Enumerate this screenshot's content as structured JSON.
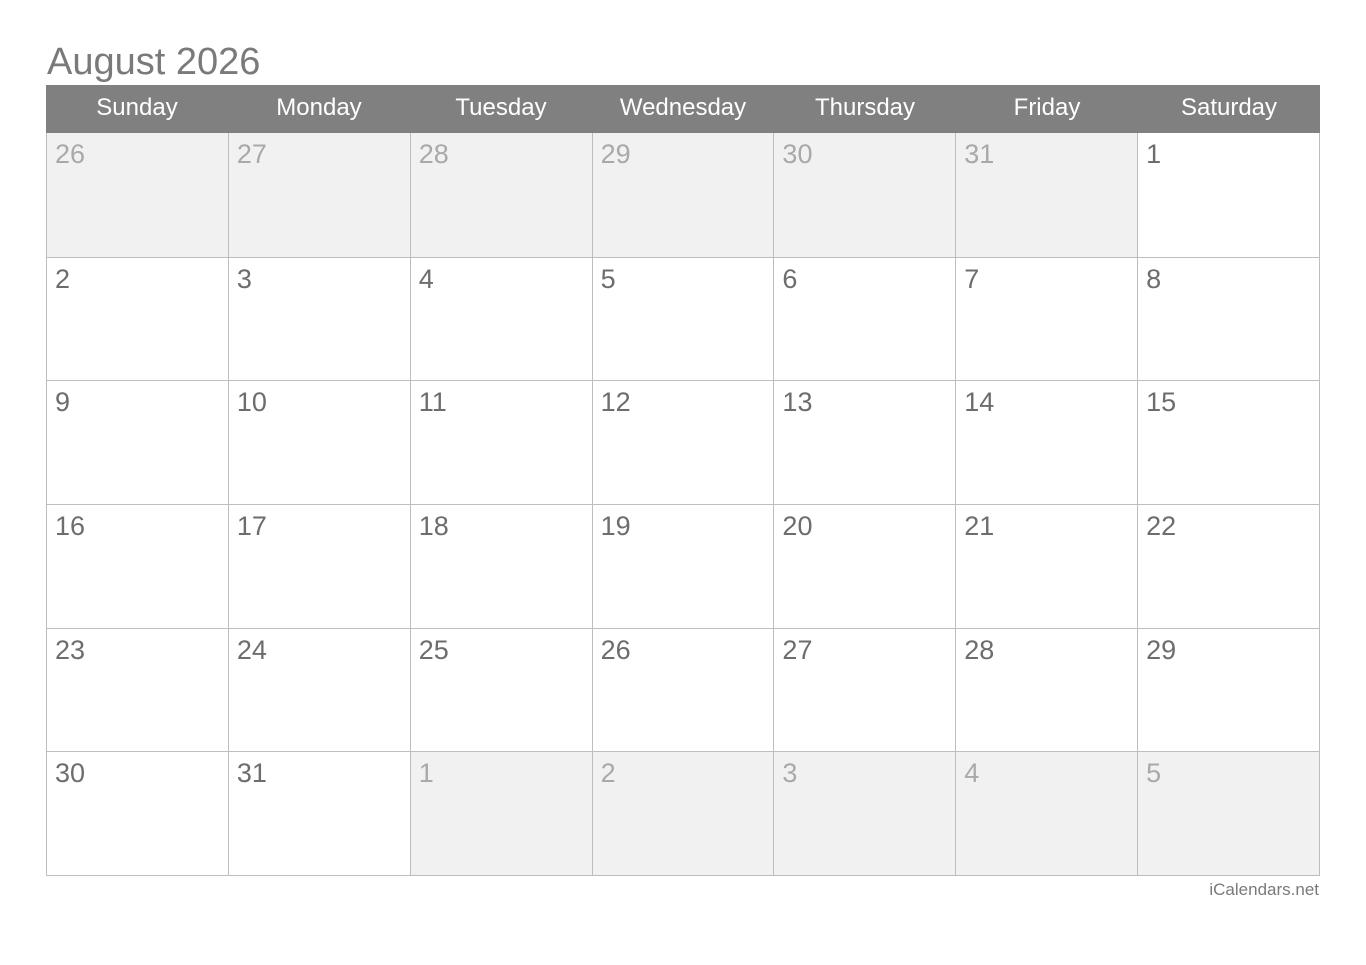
{
  "title": "August 2026",
  "weekdays": [
    "Sunday",
    "Monday",
    "Tuesday",
    "Wednesday",
    "Thursday",
    "Friday",
    "Saturday"
  ],
  "weeks": [
    [
      {
        "d": "26",
        "other": true
      },
      {
        "d": "27",
        "other": true
      },
      {
        "d": "28",
        "other": true
      },
      {
        "d": "29",
        "other": true
      },
      {
        "d": "30",
        "other": true
      },
      {
        "d": "31",
        "other": true
      },
      {
        "d": "1",
        "other": false
      }
    ],
    [
      {
        "d": "2",
        "other": false
      },
      {
        "d": "3",
        "other": false
      },
      {
        "d": "4",
        "other": false
      },
      {
        "d": "5",
        "other": false
      },
      {
        "d": "6",
        "other": false
      },
      {
        "d": "7",
        "other": false
      },
      {
        "d": "8",
        "other": false
      }
    ],
    [
      {
        "d": "9",
        "other": false
      },
      {
        "d": "10",
        "other": false
      },
      {
        "d": "11",
        "other": false
      },
      {
        "d": "12",
        "other": false
      },
      {
        "d": "13",
        "other": false
      },
      {
        "d": "14",
        "other": false
      },
      {
        "d": "15",
        "other": false
      }
    ],
    [
      {
        "d": "16",
        "other": false
      },
      {
        "d": "17",
        "other": false
      },
      {
        "d": "18",
        "other": false
      },
      {
        "d": "19",
        "other": false
      },
      {
        "d": "20",
        "other": false
      },
      {
        "d": "21",
        "other": false
      },
      {
        "d": "22",
        "other": false
      }
    ],
    [
      {
        "d": "23",
        "other": false
      },
      {
        "d": "24",
        "other": false
      },
      {
        "d": "25",
        "other": false
      },
      {
        "d": "26",
        "other": false
      },
      {
        "d": "27",
        "other": false
      },
      {
        "d": "28",
        "other": false
      },
      {
        "d": "29",
        "other": false
      }
    ],
    [
      {
        "d": "30",
        "other": false
      },
      {
        "d": "31",
        "other": false
      },
      {
        "d": "1",
        "other": true
      },
      {
        "d": "2",
        "other": true
      },
      {
        "d": "3",
        "other": true
      },
      {
        "d": "4",
        "other": true
      },
      {
        "d": "5",
        "other": true
      }
    ]
  ],
  "footer": "iCalendars.net"
}
